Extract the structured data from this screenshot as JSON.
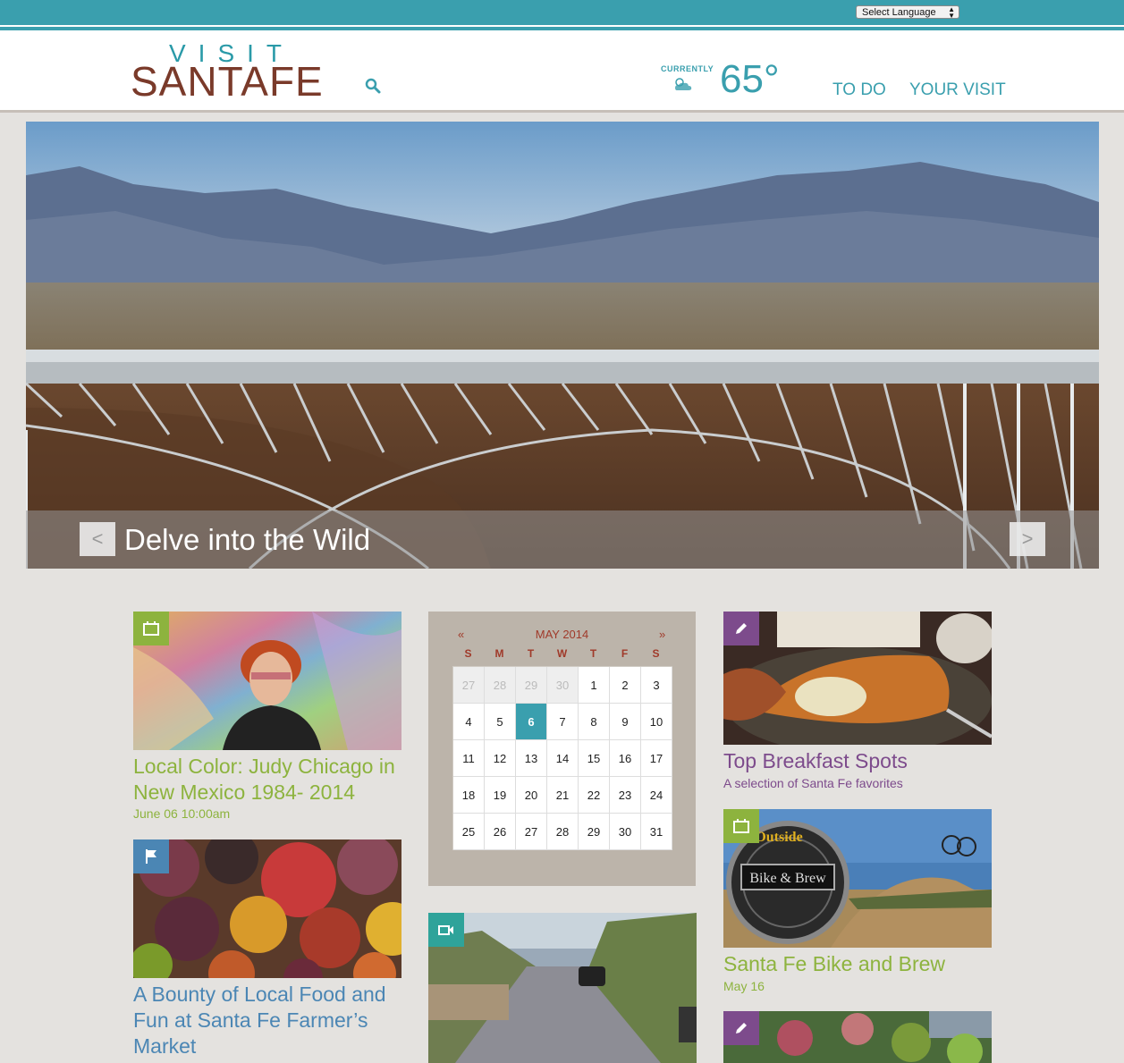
{
  "topbar": {
    "language_select": "Select Language"
  },
  "header": {
    "logo_top": "VISIT",
    "logo_main": "SANTAFE",
    "weather_label": "CURRENTLY",
    "weather_temp": "65°",
    "nav": {
      "todo": "TO DO",
      "your_visit": "YOUR VISIT"
    }
  },
  "hero": {
    "title": "Delve into the Wild",
    "prev": "<",
    "next": ">"
  },
  "cards": {
    "judy": {
      "title": "Local Color: Judy Chicago in New Mexico 1984- 2014",
      "subtitle": "June 06 10:00am",
      "badge_icon": "calendar-icon"
    },
    "market": {
      "title": "A Bounty of Local Food and Fun at Santa Fe Farmer’s Market",
      "badge_icon": "flag-icon"
    },
    "breakfast": {
      "title": "Top Breakfast Spots",
      "subtitle": "A selection of Santa Fe favorites",
      "badge_icon": "pencil-icon"
    },
    "bike": {
      "title": "Santa Fe Bike and Brew",
      "subtitle": "May 16",
      "badge_icon": "calendar-icon",
      "sign_top": "Outside",
      "sign_mid": "Bike & Brew"
    },
    "video": {
      "badge_icon": "video-camera-icon"
    },
    "garden": {
      "badge_icon": "pencil-icon"
    }
  },
  "calendar": {
    "month": "MAY 2014",
    "prev": "«",
    "next": "»",
    "dow": [
      "S",
      "M",
      "T",
      "W",
      "T",
      "F",
      "S"
    ],
    "weeks": [
      [
        "27",
        "28",
        "29",
        "30",
        "1",
        "2",
        "3"
      ],
      [
        "4",
        "5",
        "6",
        "7",
        "8",
        "9",
        "10"
      ],
      [
        "11",
        "12",
        "13",
        "14",
        "15",
        "16",
        "17"
      ],
      [
        "18",
        "19",
        "20",
        "21",
        "22",
        "23",
        "24"
      ],
      [
        "25",
        "26",
        "27",
        "28",
        "29",
        "30",
        "31"
      ]
    ],
    "muted_first_week": 4,
    "today": "6"
  },
  "colors": {
    "teal": "#3a9fae",
    "green": "#8db33e",
    "blue": "#4b86b4",
    "purple": "#7d4b8c",
    "brown": "#7a3a2a"
  }
}
